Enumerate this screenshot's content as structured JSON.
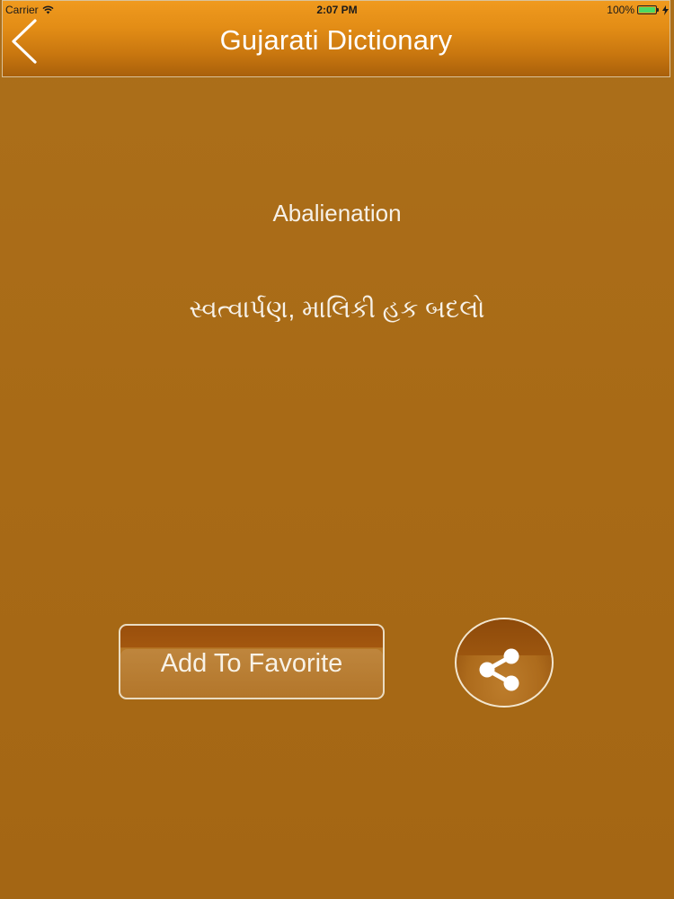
{
  "status_bar": {
    "carrier": "Carrier",
    "time": "2:07 PM",
    "battery": "100%",
    "wifi_icon": "wifi-icon",
    "charging_icon": "bolt-icon"
  },
  "nav": {
    "title": "Gujarati Dictionary",
    "back_icon": "chevron-left-icon"
  },
  "entry": {
    "english": "Abalienation",
    "gujarati": "સ્વત્વાર્પણ, માલિકી હક બદલો"
  },
  "actions": {
    "favorite_label": "Add To Favorite",
    "share_icon": "share-icon"
  },
  "colors": {
    "background": "#a86a17",
    "nav_top": "#f09a1e",
    "nav_bottom": "#a9600b",
    "text": "#f6f1e8",
    "battery": "#4cd964"
  }
}
